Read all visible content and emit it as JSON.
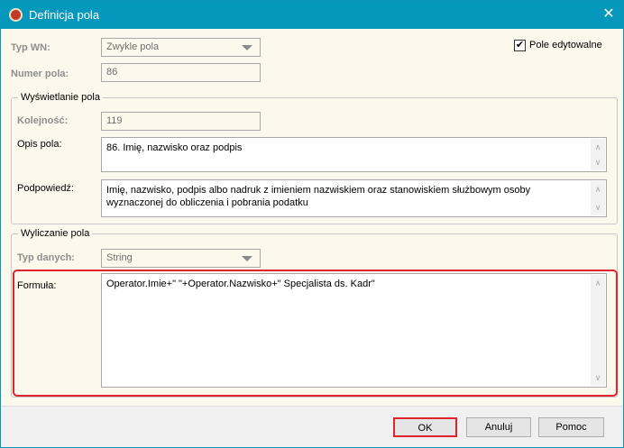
{
  "window": {
    "title": "Definicja pola",
    "close": "✕"
  },
  "typ_wn": {
    "label": "Typ WN:",
    "value": "Zwykle pola"
  },
  "numer_pola": {
    "label": "Numer pola:",
    "value": "86"
  },
  "pole_edytowalne": {
    "label": "Pole edytowalne",
    "checked": true,
    "mark": "✔"
  },
  "wyswietlanie": {
    "legend": "Wyświetlanie pola",
    "kolejnosc": {
      "label": "Kolejność:",
      "value": "119"
    },
    "opis": {
      "label": "Opis pola:",
      "value": "86. Imię, nazwisko oraz podpis"
    },
    "podpowiedz": {
      "label": "Podpowiedź:",
      "value": "Imię, nazwisko, podpis albo nadruk z imieniem nazwiskiem oraz stanowiskiem służbowym osoby wyznaczonej do obliczenia i pobrania podatku"
    }
  },
  "wyliczanie": {
    "legend": "Wyliczanie pola",
    "typ_danych": {
      "label": "Typ danych:",
      "value": "String"
    },
    "formula": {
      "label": "Formuła:",
      "value": "Operator.Imie+\" \"+Operator.Nazwisko+\" Specjalista ds. Kadr\""
    }
  },
  "buttons": {
    "ok": "OK",
    "cancel": "Anuluj",
    "help": "Pomoc"
  },
  "scroll": {
    "up": "∧",
    "down": "∨"
  }
}
